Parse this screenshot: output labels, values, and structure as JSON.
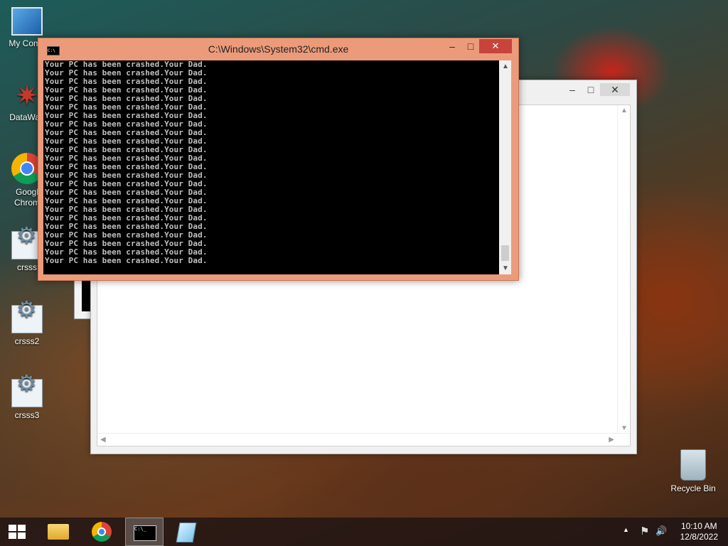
{
  "desktop": {
    "icons": [
      {
        "label": "My Comp",
        "icon": "computer-icon"
      },
      {
        "label": "DataWag",
        "icon": "datawag-icon"
      },
      {
        "label": "Googl",
        "label2": "Chrom",
        "icon": "chrome-icon"
      },
      {
        "label": "crsss",
        "icon": "gear-icon"
      },
      {
        "label": "crsss2",
        "icon": "gear-icon"
      },
      {
        "label": "crsss3",
        "icon": "gear-icon"
      },
      {
        "label": "Recycle Bin",
        "icon": "recycle-bin-icon"
      }
    ]
  },
  "cmd_window": {
    "title": "C:\\Windows\\System32\\cmd.exe",
    "lines": [
      "Your PC has been crashed.Your Dad.",
      "Your PC has been crashed.Your Dad.",
      "Your PC has been crashed.Your Dad.",
      "Your PC has been crashed.Your Dad.",
      "Your PC has been crashed.Your Dad.",
      "Your PC has been crashed.Your Dad.",
      "Your PC has been crashed.Your Dad.",
      "Your PC has been crashed.Your Dad.",
      "Your PC has been crashed.Your Dad.",
      "Your PC has been crashed.Your Dad.",
      "Your PC has been crashed.Your Dad.",
      "Your PC has been crashed.Your Dad.",
      "Your PC has been crashed.Your Dad.",
      "Your PC has been crashed.Your Dad.",
      "Your PC has been crashed.Your Dad.",
      "Your PC has been crashed.Your Dad.",
      "Your PC has been crashed.Your Dad.",
      "Your PC has been crashed.Your Dad.",
      "Your PC has been crashed.Your Dad.",
      "Your PC has been crashed.Your Dad.",
      "Your PC has been crashed.Your Dad.",
      "Your PC has been crashed.Your Dad.",
      "Your PC has been crashed.Your Dad.",
      "Your PC has been crashed.Your Dad."
    ],
    "buttons": {
      "minimize": "–",
      "maximize": "□",
      "close": "✕"
    },
    "console_bg": "#000000",
    "frame_color": "#ec9b7a"
  },
  "background_window": {
    "buttons": {
      "minimize": "–",
      "maximize": "□",
      "close": "✕"
    }
  },
  "taskbar": {
    "start_icon": "windows-start-icon",
    "pinned": [
      "file-explorer-icon",
      "chrome-icon",
      "cmd-icon",
      "notepad-icon"
    ],
    "active": "cmd-icon",
    "tray": {
      "show_hidden": "▲",
      "flag": "⚑",
      "volume": "🔊"
    },
    "clock": {
      "time": "10:10 AM",
      "date": "12/8/2022"
    }
  }
}
